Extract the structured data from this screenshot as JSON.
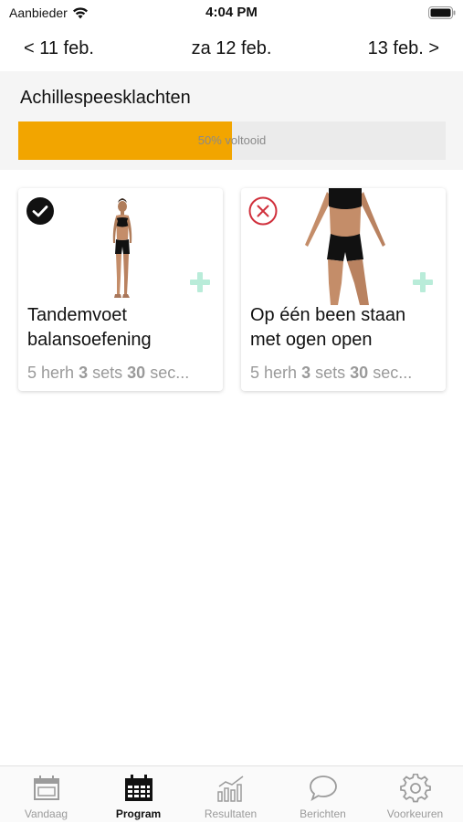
{
  "status_bar": {
    "carrier": "Aanbieder",
    "time": "4:04 PM"
  },
  "date_nav": {
    "prev": "< 11 feb.",
    "current": "za 12 feb.",
    "next": "13 feb. >"
  },
  "program": {
    "title": "Achillespeesklachten",
    "progress_label": "50% voltooid",
    "progress_fraction": 0.5,
    "progress_color": "#f2a500"
  },
  "exercises": [
    {
      "title": "Tandemvoet balansoefening",
      "status": "completed",
      "status_icon": "check-circle-icon",
      "reps_value": "5",
      "reps_unit": "herh",
      "sets_value": "3",
      "sets_unit": "sets",
      "time_value": "30",
      "time_unit": "sec..."
    },
    {
      "title": "Op één been staan met ogen open",
      "status": "skipped",
      "status_icon": "x-circle-icon",
      "reps_value": "5",
      "reps_unit": "herh",
      "sets_value": "3",
      "sets_unit": "sets",
      "time_value": "30",
      "time_unit": "sec..."
    }
  ],
  "tabs": [
    {
      "label": "Vandaag",
      "icon": "calendar-icon",
      "active": false
    },
    {
      "label": "Program",
      "icon": "program-calendar-icon",
      "active": true
    },
    {
      "label": "Resultaten",
      "icon": "chart-icon",
      "active": false
    },
    {
      "label": "Berichten",
      "icon": "chat-bubble-icon",
      "active": false
    },
    {
      "label": "Voorkeuren",
      "icon": "gear-icon",
      "active": false
    }
  ],
  "colors": {
    "accent": "#f2a500",
    "add": "#b9ecd9",
    "skip": "#d0303c"
  }
}
